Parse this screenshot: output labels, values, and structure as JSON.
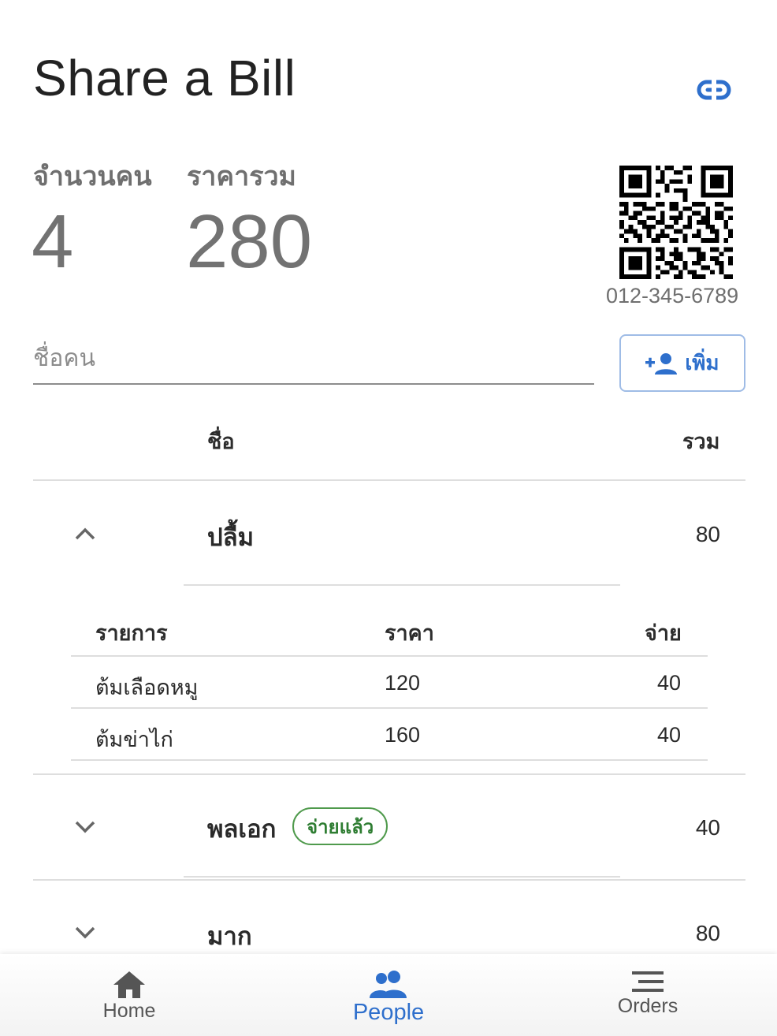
{
  "header": {
    "title": "Share a Bill"
  },
  "stats": {
    "people_label": "จำนวนคน",
    "people_value": "4",
    "total_label": "ราคารวม",
    "total_value": "280"
  },
  "payment": {
    "phone": "012-345-6789"
  },
  "add_person": {
    "placeholder": "ชื่อคน",
    "value": "",
    "button_label": "เพิ่ม"
  },
  "table": {
    "col_name": "ชื่อ",
    "col_total": "รวม",
    "people": [
      {
        "name": "ปลื้ม",
        "total": "80",
        "expanded": true,
        "items_header": {
          "item": "รายการ",
          "price": "ราคา",
          "pay": "จ่าย"
        },
        "items": [
          {
            "item": "ต้มเลือดหมู",
            "price": "120",
            "pay": "40"
          },
          {
            "item": "ต้มข่าไก่",
            "price": "160",
            "pay": "40"
          }
        ]
      },
      {
        "name": "พลเอก",
        "total": "40",
        "expanded": false,
        "badge": "จ่ายแล้ว"
      },
      {
        "name": "มาก",
        "total": "80",
        "expanded": false
      }
    ]
  },
  "nav": {
    "items": [
      {
        "label": "Home",
        "icon": "home-icon"
      },
      {
        "label": "People",
        "icon": "people-icon",
        "active": true
      },
      {
        "label": "Orders",
        "icon": "list-icon"
      }
    ]
  },
  "colors": {
    "accent": "#2e6fcc",
    "paid_green": "#2e7d32",
    "muted_text": "#727272"
  }
}
